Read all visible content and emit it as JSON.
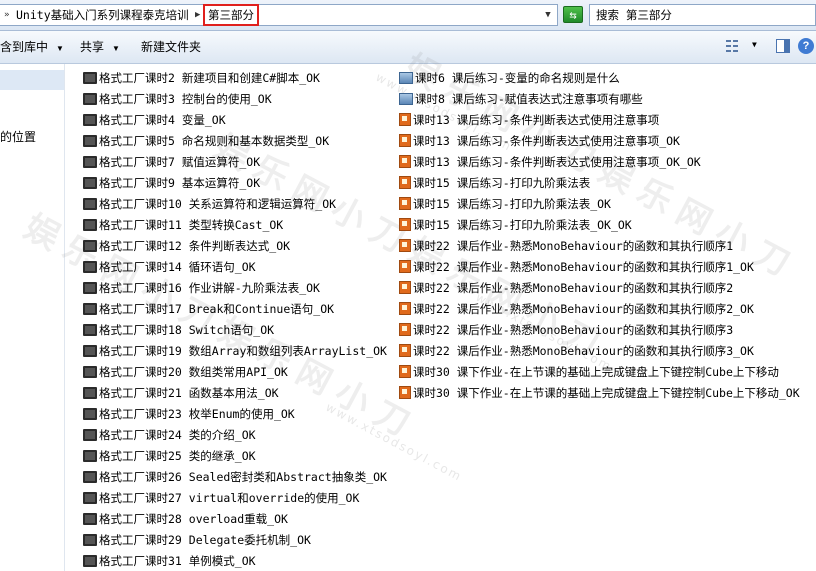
{
  "address_bar": {
    "crumbs": [
      "Unity基础入门系列课程泰克培训",
      "第三部分"
    ],
    "search_placeholder": "搜索 第三部分"
  },
  "toolbar": {
    "include_library_label": "含到库中",
    "share_label": "共享",
    "new_folder_label": "新建文件夹"
  },
  "nav": {
    "item_label": "的位置"
  },
  "watermark": {
    "text": "娱乐网小刀娱乐网小刀",
    "url": "www.xtsodsoyl.com"
  },
  "files": {
    "column1": [
      {
        "name": "格式工厂课时2 新建项目和创建C#脚本_OK",
        "icon": "video-icon"
      },
      {
        "name": "格式工厂课时3 控制台的使用_OK",
        "icon": "video-icon"
      },
      {
        "name": "格式工厂课时4 变量_OK",
        "icon": "video-icon"
      },
      {
        "name": "格式工厂课时5 命名规则和基本数据类型_OK",
        "icon": "video-icon"
      },
      {
        "name": "格式工厂课时7 赋值运算符_OK",
        "icon": "video-icon"
      },
      {
        "name": "格式工厂课时9 基本运算符_OK",
        "icon": "video-icon"
      },
      {
        "name": "格式工厂课时10   关系运算符和逻辑运算符_OK",
        "icon": "video-icon"
      },
      {
        "name": "格式工厂课时11 类型转换Cast_OK",
        "icon": "video-icon"
      },
      {
        "name": "格式工厂课时12 条件判断表达式_OK",
        "icon": "video-icon"
      },
      {
        "name": "格式工厂课时14 循环语句_OK",
        "icon": "video-icon"
      },
      {
        "name": "格式工厂课时16 作业讲解-九阶乘法表_OK",
        "icon": "video-icon"
      },
      {
        "name": "格式工厂课时17 Break和Continue语句_OK",
        "icon": "video-icon"
      },
      {
        "name": "格式工厂课时18 Switch语句_OK",
        "icon": "video-icon"
      },
      {
        "name": "格式工厂课时19 数组Array和数组列表ArrayList_OK",
        "icon": "video-icon"
      },
      {
        "name": "格式工厂课时20 数组类常用API_OK",
        "icon": "video-icon"
      },
      {
        "name": "格式工厂课时21 函数基本用法_OK",
        "icon": "video-icon"
      },
      {
        "name": "格式工厂课时23 枚举Enum的使用_OK",
        "icon": "video-icon"
      },
      {
        "name": "格式工厂课时24 类的介绍_OK",
        "icon": "video-icon"
      },
      {
        "name": "格式工厂课时25 类的继承_OK",
        "icon": "video-icon"
      },
      {
        "name": "格式工厂课时26 Sealed密封类和Abstract抽象类_OK",
        "icon": "video-icon"
      },
      {
        "name": "格式工厂课时27 virtual和override的使用_OK",
        "icon": "video-icon"
      },
      {
        "name": "格式工厂课时28 overload重载_OK",
        "icon": "video-icon"
      },
      {
        "name": "格式工厂课时29 Delegate委托机制_OK",
        "icon": "video-icon"
      },
      {
        "name": "格式工厂课时31 单例模式_OK",
        "icon": "video-icon"
      }
    ],
    "column2": [
      {
        "name": "课时6 课后练习-变量的命名规则是什么",
        "icon": "image-icon"
      },
      {
        "name": "课时8 课后练习-赋值表达式注意事项有哪些",
        "icon": "image-icon"
      },
      {
        "name": "课时13 课后练习-条件判断表达式使用注意事项",
        "icon": "ppt-icon"
      },
      {
        "name": "课时13 课后练习-条件判断表达式使用注意事项_OK",
        "icon": "ppt-icon"
      },
      {
        "name": "课时13 课后练习-条件判断表达式使用注意事项_OK_OK",
        "icon": "ppt-icon"
      },
      {
        "name": "课时15 课后练习-打印九阶乘法表",
        "icon": "ppt-icon"
      },
      {
        "name": "课时15 课后练习-打印九阶乘法表_OK",
        "icon": "ppt-icon"
      },
      {
        "name": "课时15 课后练习-打印九阶乘法表_OK_OK",
        "icon": "ppt-icon"
      },
      {
        "name": "课时22 课后作业-熟悉MonoBehaviour的函数和其执行顺序1",
        "icon": "ppt-icon"
      },
      {
        "name": "课时22 课后作业-熟悉MonoBehaviour的函数和其执行顺序1_OK",
        "icon": "ppt-icon"
      },
      {
        "name": "课时22 课后作业-熟悉MonoBehaviour的函数和其执行顺序2",
        "icon": "ppt-icon"
      },
      {
        "name": "课时22 课后作业-熟悉MonoBehaviour的函数和其执行顺序2_OK",
        "icon": "ppt-icon"
      },
      {
        "name": "课时22 课后作业-熟悉MonoBehaviour的函数和其执行顺序3",
        "icon": "ppt-icon"
      },
      {
        "name": "课时22 课后作业-熟悉MonoBehaviour的函数和其执行顺序3_OK",
        "icon": "ppt-icon"
      },
      {
        "name": "课时30 课下作业-在上节课的基础上完成键盘上下键控制Cube上下移动",
        "icon": "ppt-icon"
      },
      {
        "name": "课时30 课下作业-在上节课的基础上完成键盘上下键控制Cube上下移动_OK",
        "icon": "ppt-icon"
      }
    ]
  }
}
